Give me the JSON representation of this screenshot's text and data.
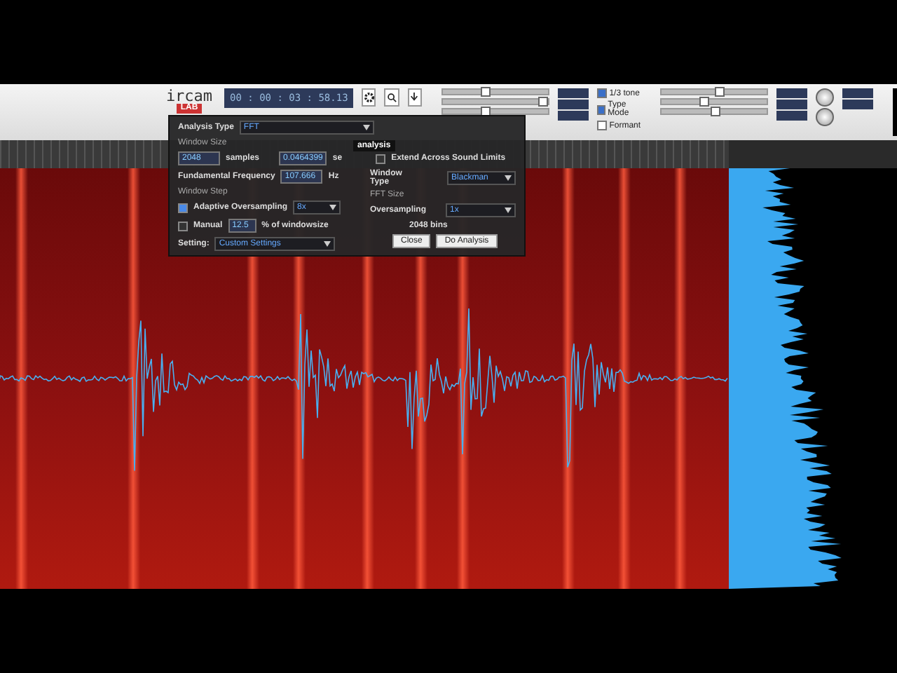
{
  "toolbar": {
    "logo_top": "ircam",
    "logo_bottom": "LAB",
    "timecode": "00 : 00 : 03 : 58.13",
    "tooltip": "analysis",
    "sliders": [
      {
        "level": 0.4
      },
      {
        "level": 0.95
      },
      {
        "level": 0.4
      },
      {
        "level": 0.55
      },
      {
        "level": 0.4
      },
      {
        "level": 0.5
      }
    ],
    "options": [
      {
        "label": "1/3 tone",
        "checked": true
      },
      {
        "label": "Type Mode",
        "checked": true
      },
      {
        "label": "Formant",
        "checked": false
      }
    ]
  },
  "dialog": {
    "analysis_type_label": "Analysis Type",
    "analysis_type": "FFT",
    "window_size_heading": "Window Size",
    "samples": "2048",
    "samples_unit": "samples",
    "seconds": "0.0464399",
    "seconds_unit": "se",
    "extend": {
      "label": "Extend Across Sound Limits",
      "checked": false
    },
    "fundamental_label": "Fundamental Frequency",
    "fundamental": "107.666",
    "fundamental_unit": "Hz",
    "window_type_label": "Window Type",
    "window_type": "Blackman",
    "window_step_heading": "Window Step",
    "fft_size_heading": "FFT Size",
    "adaptive": {
      "label": "Adaptive Oversampling",
      "checked": true
    },
    "adaptive_value": "8x",
    "oversampling_label": "Oversampling",
    "oversampling": "1x",
    "manual": {
      "label": "Manual",
      "checked": false
    },
    "manual_value": "12.5",
    "manual_unit": "% of windowsize",
    "bins": "2048 bins",
    "setting_label": "Setting:",
    "setting": "Custom Settings",
    "buttons": [
      "Close",
      "Do Analysis"
    ]
  }
}
